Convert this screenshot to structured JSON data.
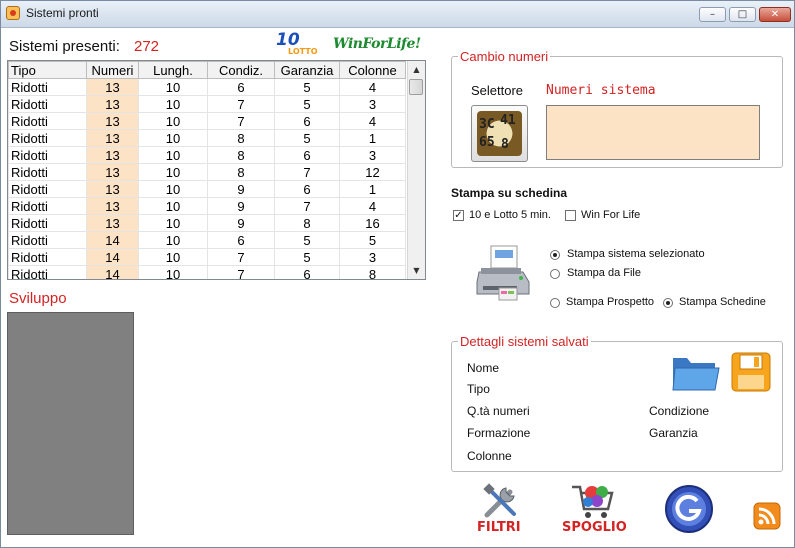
{
  "window": {
    "title": "Sistemi pronti"
  },
  "header": {
    "presenti_label": "Sistemi presenti:",
    "presenti_count": "272"
  },
  "logos": {
    "lotto_top": "10",
    "lotto_bottom": "LOTTO",
    "winforlife": "WinForLife!"
  },
  "table": {
    "columns": [
      "Tipo",
      "Numeri",
      "Lungh.",
      "Condiz.",
      "Garanzia",
      "Colonne"
    ],
    "rows": [
      [
        "Ridotti",
        "13",
        "10",
        "6",
        "5",
        "4"
      ],
      [
        "Ridotti",
        "13",
        "10",
        "7",
        "5",
        "3"
      ],
      [
        "Ridotti",
        "13",
        "10",
        "7",
        "6",
        "4"
      ],
      [
        "Ridotti",
        "13",
        "10",
        "8",
        "5",
        "1"
      ],
      [
        "Ridotti",
        "13",
        "10",
        "8",
        "6",
        "3"
      ],
      [
        "Ridotti",
        "13",
        "10",
        "8",
        "7",
        "12"
      ],
      [
        "Ridotti",
        "13",
        "10",
        "9",
        "6",
        "1"
      ],
      [
        "Ridotti",
        "13",
        "10",
        "9",
        "7",
        "4"
      ],
      [
        "Ridotti",
        "13",
        "10",
        "9",
        "8",
        "16"
      ],
      [
        "Ridotti",
        "14",
        "10",
        "6",
        "5",
        "5"
      ],
      [
        "Ridotti",
        "14",
        "10",
        "7",
        "5",
        "3"
      ],
      [
        "Ridotti",
        "14",
        "10",
        "7",
        "6",
        "8"
      ]
    ]
  },
  "sviluppo": {
    "label": "Sviluppo"
  },
  "cambio": {
    "legend": "Cambio numeri",
    "selettore_label": "Selettore",
    "numeri_sistema_label": "Numeri sistema",
    "selector_image_digits": [
      "3C",
      "41",
      "65",
      "8"
    ]
  },
  "stampa": {
    "title": "Stampa su schedina",
    "check_lotto": {
      "label": "10 e Lotto 5 min.",
      "checked": true
    },
    "check_wfl": {
      "label": "Win For Life",
      "checked": false
    },
    "radio_selezionato": "Stampa sistema selezionato",
    "radio_file": "Stampa da File",
    "radio_prospetto": "Stampa Prospetto",
    "radio_schedine": "Stampa Schedine",
    "selected_source": "Stampa sistema selezionato",
    "selected_mode": "Stampa Schedine"
  },
  "dettagli": {
    "legend": "Dettagli sistemi salvati",
    "nome": "Nome",
    "tipo": "Tipo",
    "qta": "Q.tà numeri",
    "condizione": "Condizione",
    "formazione": "Formazione",
    "garanzia": "Garanzia",
    "colonne": "Colonne"
  },
  "tools": {
    "filtri": "FILTRI",
    "spoglio": "SPOGLIO"
  },
  "icons": [
    "app-icon",
    "folder-icon",
    "save-icon",
    "printer-icon",
    "tools-icon",
    "cart-icon",
    "g-logo-icon",
    "rss-icon"
  ]
}
